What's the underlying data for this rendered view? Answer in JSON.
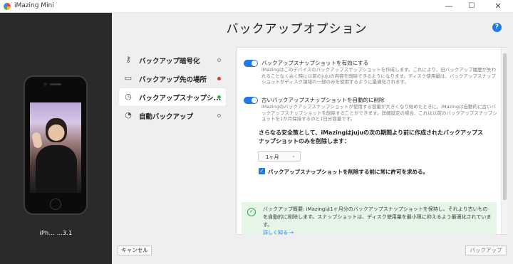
{
  "window": {
    "app_title": "iMazing Mini",
    "minimize_glyph": "—",
    "maximize_glyph": "☐",
    "close_glyph": "✕"
  },
  "device": {
    "name": "iPh… …3.1"
  },
  "page": {
    "title": "バックアップオプション",
    "help_glyph": "?"
  },
  "nav": {
    "items": [
      {
        "label": "バックアップ暗号化",
        "icon": "key-icon",
        "status": "empty"
      },
      {
        "label": "バックアップ先の場所",
        "icon": "folder-icon",
        "status": "red"
      },
      {
        "label": "バックアップスナップシ...",
        "icon": "snapshot-clock-icon",
        "status": "green"
      },
      {
        "label": "自動バックアップ",
        "icon": "clock-icon",
        "status": "empty"
      }
    ],
    "active_index": 2
  },
  "options": {
    "snapshots_toggle": {
      "label": "バックアップスナップショットを有効にする",
      "enabled": true,
      "description": "iMazingはこのデバイスのバックアップスナップショットを作成します。これにより、旧バックアップ履歴が失われることなく古く時に以前のjujuの内容を削除できるようになります。ディスク使用量は、バックアップスナップショットがディスク領域の一部のみを使用するように最適化されます。"
    },
    "auto_delete_toggle": {
      "label": "古いバックアップスナップショットを自動的に削除",
      "enabled": true,
      "description": "iMazingのバックアップスナップショットが使用する容量が大きくなり始めたときに、iMazingは自動的に古いバックアップスナップショットを削除することができます。詳細設定の場合、これは以前のバックアップスナップショットを1か月保持するのと1日分容量です。"
    },
    "retention_text": "さらなる安全策として、iMazingはjujuの次の期間より前に作成されたバックアップスナップショットのみを削除します：",
    "retention_value": "1ヶ月",
    "confirm_checkbox": {
      "label": "バックアップスナップショットを削除する前に常に許可を求める。",
      "checked": true
    }
  },
  "summary": {
    "text": "バックアップ概要: iMazingは1ヶ月分のバックアップスナップショットを保持し、それより古いものを自動的に削除します。スナップショットは、ディスク使用量を最小限に抑えるよう最適化されています。",
    "link": "詳しく知る →"
  },
  "footer": {
    "cancel_label": "キャンセル",
    "backup_label": "バックアップ"
  },
  "colors": {
    "accent": "#1f7ae8",
    "status_red": "#e0382f",
    "status_green": "#34b34a",
    "summary_bg": "#e6f6e6"
  }
}
